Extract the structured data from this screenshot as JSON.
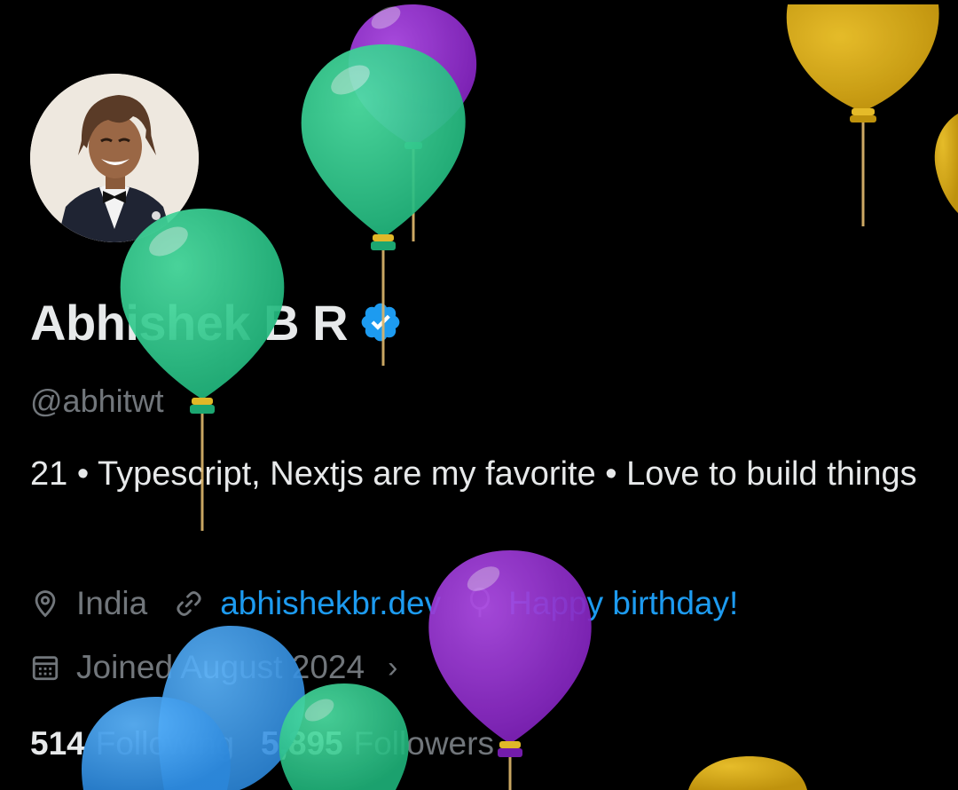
{
  "profile": {
    "display_name": "Abhishek B R",
    "handle": "@abhitwt",
    "bio": "21 • Typescript, Nextjs are my favorite • Love to build things",
    "verified": true
  },
  "meta": {
    "location": "India",
    "website": "abhishekbr.dev",
    "birthday": "Happy birthday!",
    "joined": "Joined August 2024"
  },
  "stats": {
    "following_count": "514",
    "following_label": "Following",
    "followers_count": "5,895",
    "followers_label": "Followers"
  },
  "colors": {
    "background": "#000000",
    "text_primary": "#e7e9ea",
    "text_secondary": "#71767b",
    "link": "#1d9bf0",
    "verified_badge": "#1d9bf0",
    "balloon_green": "#2fd28e",
    "balloon_purple": "#9b30d9",
    "balloon_yellow": "#e6b316",
    "balloon_blue": "#3aa0f0"
  },
  "icons": {
    "location": "location-pin-icon",
    "website": "link-icon",
    "birthday": "balloon-icon",
    "joined": "calendar-icon",
    "verified": "verified-badge-icon"
  }
}
